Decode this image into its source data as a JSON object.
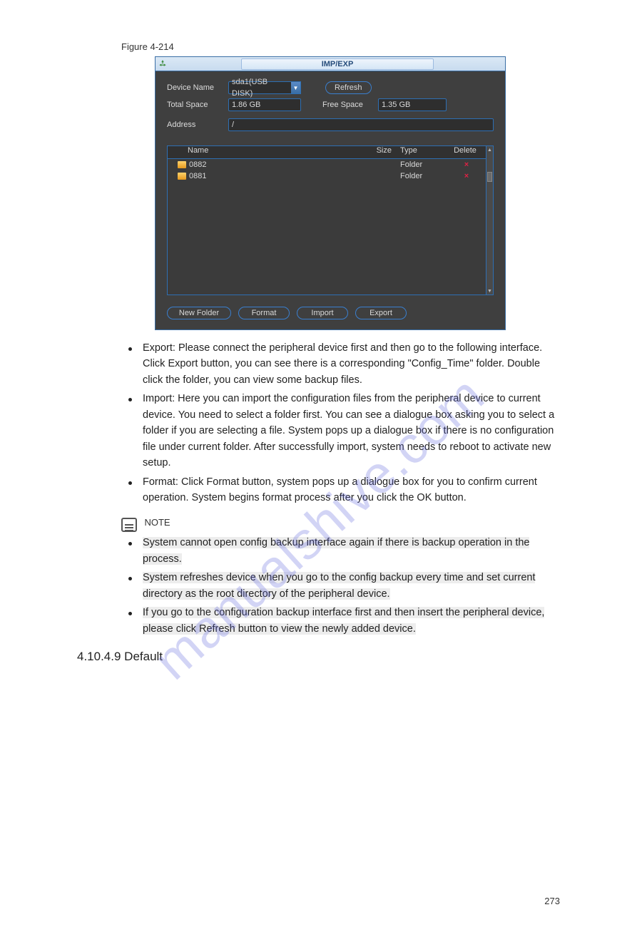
{
  "figure_caption": "Figure 4-214",
  "dialog": {
    "title": "IMP/EXP",
    "device_name_label": "Device Name",
    "device_name_value": "sda1(USB DISK)",
    "refresh": "Refresh",
    "total_space_label": "Total Space",
    "total_space_value": "1.86 GB",
    "free_space_label": "Free Space",
    "free_space_value": "1.35 GB",
    "address_label": "Address",
    "address_value": "/",
    "table_headers": {
      "name": "Name",
      "size": "Size",
      "type": "Type",
      "del": "Delete"
    },
    "rows": [
      {
        "name": "0882",
        "size": "",
        "type": "Folder"
      },
      {
        "name": "0881",
        "size": "",
        "type": "Folder"
      }
    ],
    "buttons": {
      "newfolder": "New Folder",
      "format": "Format",
      "import": "Import",
      "export": "Export"
    }
  },
  "body": {
    "p1": "Export: Please connect the peripheral device first and then go to the following interface. Click Export button, you can see there is a corresponding \"Config_Time\" folder. Double click the folder, you can view some backup files.",
    "p2": "Import: Here you can import the configuration files from the peripheral device to current device. You need to select a folder first. You can see a dialogue box asking you to select a folder if you are selecting a file. System pops up a dialogue box if there is no configuration file under current folder. After successfully import, system needs to reboot to activate new setup.",
    "p3": "Format: Click Format button, system pops up a dialogue box for you to confirm current operation. System begins format process after you click the OK button.",
    "note_heading": "NOTE",
    "notes": [
      "System cannot open config backup interface again if there is backup operation in the process.",
      "System refreshes device when you go to the config backup every time and set current directory as the root directory of the peripheral device.",
      "If you go to the configuration backup interface first and then insert the peripheral device, please click Refresh button to view the newly added device."
    ]
  },
  "section_name": "4.10.4.9 Default",
  "page_number": "273",
  "watermark": "manualshive.com"
}
